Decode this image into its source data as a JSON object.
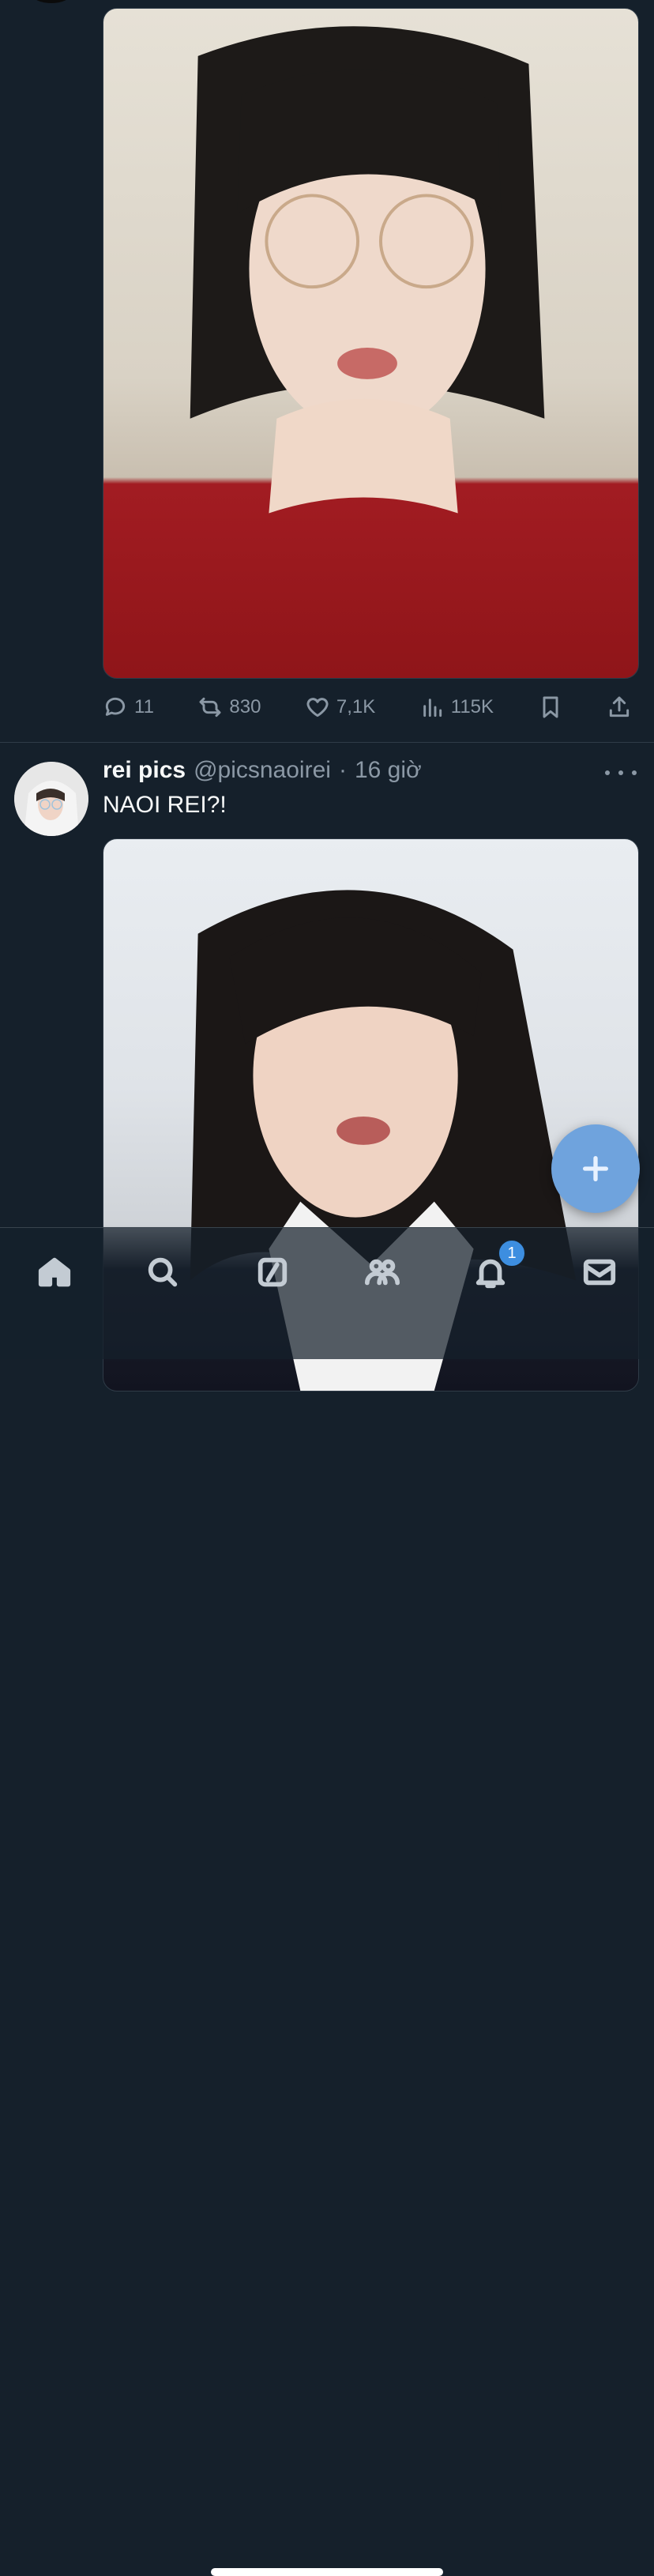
{
  "tweet_top": {
    "actions": {
      "replies": "11",
      "retweets": "830",
      "likes": "7,1K",
      "views": "115K"
    }
  },
  "tweet_second": {
    "display_name": "rei pics",
    "handle": "@picsnaoirei",
    "separator": "·",
    "time": "16 giờ",
    "text": "NAOI REI?!"
  },
  "bottom_nav": {
    "notification_count": "1"
  },
  "colors": {
    "background": "#15202b",
    "muted_text": "#8b98a5",
    "fab": "#6fa3dd",
    "badge": "#3d8ee0"
  },
  "icons": [
    "reply-icon",
    "retweet-icon",
    "like-icon",
    "views-icon",
    "bookmark-icon",
    "share-icon",
    "more-icon",
    "compose-icon",
    "home-icon",
    "search-icon",
    "grok-icon",
    "communities-icon",
    "notifications-icon",
    "messages-icon"
  ]
}
